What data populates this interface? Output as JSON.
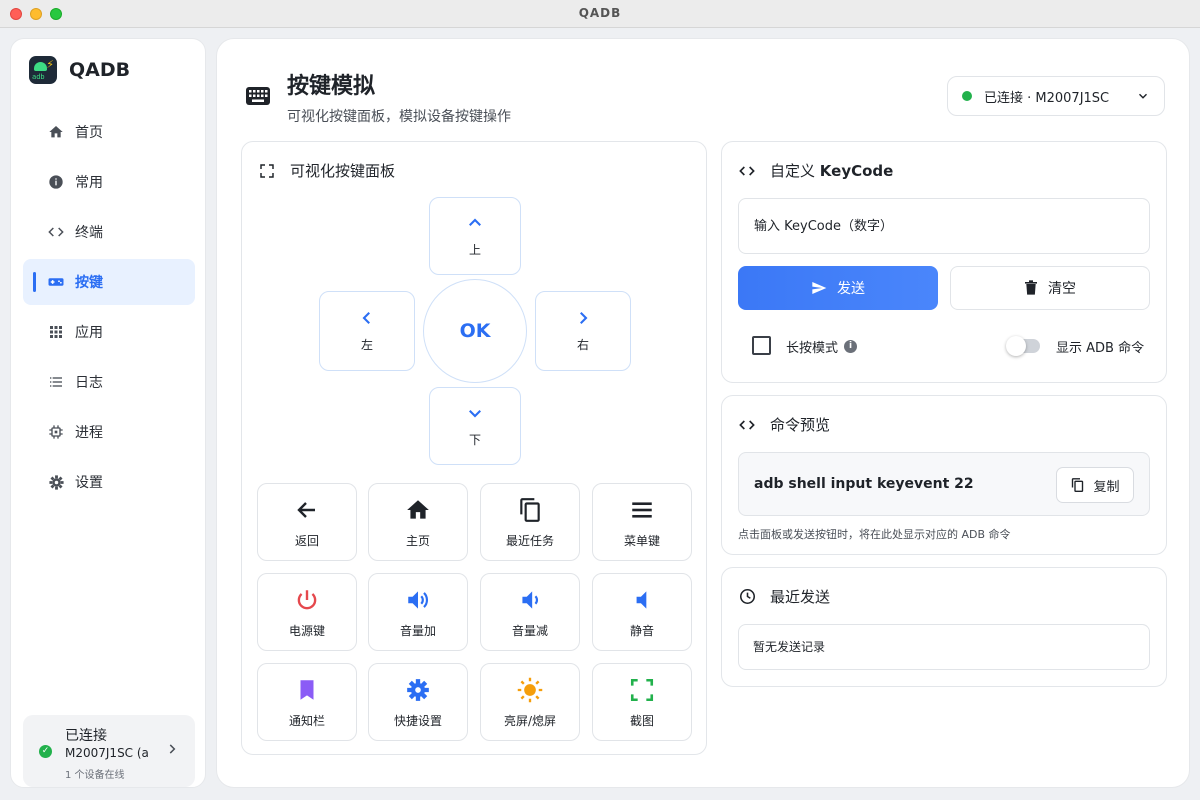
{
  "window": {
    "title": "QADB"
  },
  "sidebar": {
    "brand": "QADB",
    "logo_text": "adb",
    "items": [
      {
        "label": "首页",
        "icon": "home-icon",
        "active": false
      },
      {
        "label": "常用",
        "icon": "info-icon",
        "active": false
      },
      {
        "label": "终端",
        "icon": "code-icon",
        "active": false
      },
      {
        "label": "按键",
        "icon": "gamepad-icon",
        "active": true
      },
      {
        "label": "应用",
        "icon": "apps-grid-icon",
        "active": false
      },
      {
        "label": "日志",
        "icon": "list-icon",
        "active": false
      },
      {
        "label": "进程",
        "icon": "chip-icon",
        "active": false
      },
      {
        "label": "设置",
        "icon": "gear-icon",
        "active": false
      }
    ],
    "device": {
      "status": "已连接",
      "name": "M2007J1SC (a",
      "count": "1 个设备在线"
    }
  },
  "header": {
    "title": "按键模拟",
    "subtitle": "可视化按键面板，模拟设备按键操作",
    "connection": "已连接 · M2007J1SC"
  },
  "visual_panel": {
    "title": "可视化按键面板",
    "dpad": {
      "up": "上",
      "down": "下",
      "left": "左",
      "right": "右",
      "ok": "OK"
    },
    "keys": [
      {
        "label": "返回",
        "icon": "arrow-back-icon"
      },
      {
        "label": "主页",
        "icon": "home-icon"
      },
      {
        "label": "最近任务",
        "icon": "recent-tasks-icon"
      },
      {
        "label": "菜单键",
        "icon": "menu-icon"
      },
      {
        "label": "电源键",
        "icon": "power-icon"
      },
      {
        "label": "音量加",
        "icon": "volume-up-icon"
      },
      {
        "label": "音量减",
        "icon": "volume-down-icon"
      },
      {
        "label": "静音",
        "icon": "mute-icon"
      },
      {
        "label": "通知栏",
        "icon": "bookmark-icon"
      },
      {
        "label": "快捷设置",
        "icon": "gear-icon"
      },
      {
        "label": "亮屏/熄屏",
        "icon": "sun-icon"
      },
      {
        "label": "截图",
        "icon": "screenshot-icon"
      }
    ]
  },
  "keycode_panel": {
    "title_prefix": "自定义 ",
    "title_bold": "KeyCode",
    "placeholder": "输入 KeyCode（数字）",
    "send_label": "发送",
    "clear_label": "清空",
    "long_press_label": "长按模式",
    "long_press_checked": false,
    "show_adb_label": "显示 ADB 命令",
    "show_adb_on": false
  },
  "preview_panel": {
    "title": "命令预览",
    "command": "adb shell input keyevent 22",
    "copy_label": "复制",
    "note": "点击面板或发送按钮时，将在此处显示对应的 ADB 命令"
  },
  "recent_panel": {
    "title": "最近发送",
    "empty": "暂无发送记录"
  },
  "colors": {
    "accent": "#2b6ef3",
    "success": "#22b14c",
    "power": "#e5484d",
    "notification": "#8b5cf6",
    "brightness": "#f59e0b",
    "screenshot": "#22b14c"
  }
}
